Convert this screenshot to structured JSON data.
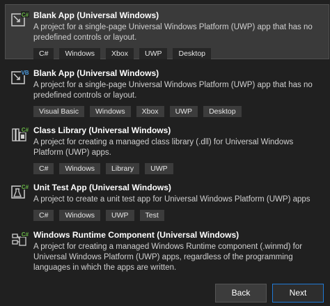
{
  "templates": [
    {
      "title": "Blank App (Universal Windows)",
      "description": "A project for a single-page Universal Windows Platform (UWP) app that has no predefined controls or layout.",
      "badge": "C#",
      "icon": "blank-app-csharp-icon",
      "tags": [
        "C#",
        "Windows",
        "Xbox",
        "UWP",
        "Desktop"
      ],
      "selected": true
    },
    {
      "title": "Blank App (Universal Windows)",
      "description": "A project for a single-page Universal Windows Platform (UWP) app that has no predefined controls or layout.",
      "badge": "VB",
      "icon": "blank-app-vb-icon",
      "tags": [
        "Visual Basic",
        "Windows",
        "Xbox",
        "UWP",
        "Desktop"
      ],
      "selected": false
    },
    {
      "title": "Class Library (Universal Windows)",
      "description": "A project for creating a managed class library (.dll) for Universal Windows Platform (UWP) apps.",
      "badge": "C#",
      "icon": "class-library-icon",
      "tags": [
        "C#",
        "Windows",
        "Library",
        "UWP"
      ],
      "selected": false
    },
    {
      "title": "Unit Test App (Universal Windows)",
      "description": "A project to create a unit test app for Universal Windows Platform (UWP) apps",
      "badge": "C#",
      "icon": "unit-test-icon",
      "tags": [
        "C#",
        "Windows",
        "UWP",
        "Test"
      ],
      "selected": false
    },
    {
      "title": "Windows Runtime Component (Universal Windows)",
      "description": "A project for creating a managed Windows Runtime component (.winmd) for Universal Windows Platform (UWP) apps, regardless of the programming languages in which the apps are written.",
      "badge": "C#",
      "icon": "runtime-component-icon",
      "tags": [],
      "selected": false
    }
  ],
  "buttons": {
    "back_label": "Back",
    "next_label": "Next"
  },
  "colors": {
    "background": "#202020",
    "selected_background": "#3a3a3a",
    "tag_background": "#3c3c3c",
    "csharp_badge": "#68b545",
    "vb_badge": "#4a9be0",
    "primary_border": "#1f7ad6"
  }
}
